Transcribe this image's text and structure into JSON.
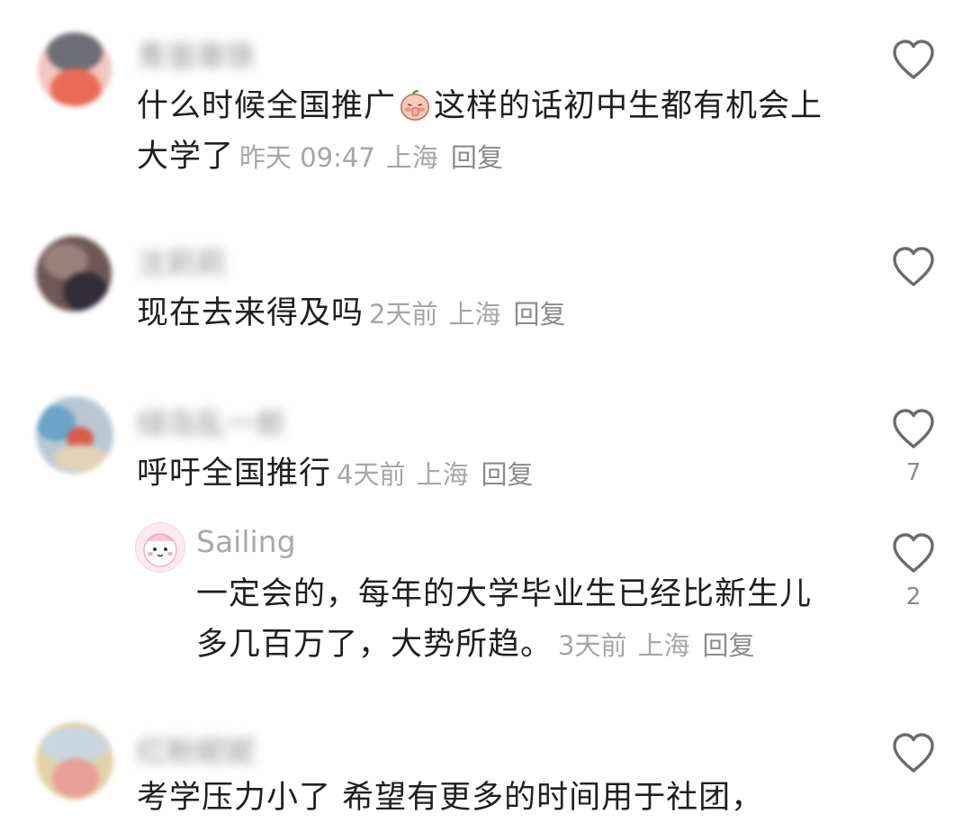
{
  "comments": [
    {
      "username": "青苗章铁",
      "text_line1_pre": "什么时候全国推广",
      "emoji": "blushing-peach-emoji",
      "text_line1_post": "这样的话初中生都有机会上",
      "text_line2": "大学了",
      "time": "昨天 09:47",
      "location": "上海",
      "reply_label": "回复",
      "likes": ""
    },
    {
      "username": "沈莉莉",
      "text": "现在去来得及吗",
      "time": "2天前",
      "location": "上海",
      "reply_label": "回复",
      "likes": ""
    },
    {
      "username": "绿岛乱一郎",
      "text": "呼吁全国推行",
      "time": "4天前",
      "location": "上海",
      "reply_label": "回复",
      "likes": "7",
      "replies": [
        {
          "username": "Sailing",
          "text_line1": "一定会的，每年的大学毕业生已经比新生儿",
          "text_line2": "多几百万了，大势所趋。",
          "time": "3天前",
          "location": "上海",
          "reply_label": "回复",
          "likes": "2"
        }
      ]
    },
    {
      "username": "红粉妮妮",
      "text": "考学压力小了 希望有更多的时间用于社团，",
      "likes": ""
    }
  ],
  "colors": {
    "text": "#1f1f1f",
    "meta": "#a6a6a6",
    "heart_stroke": "#6b6b6b"
  }
}
